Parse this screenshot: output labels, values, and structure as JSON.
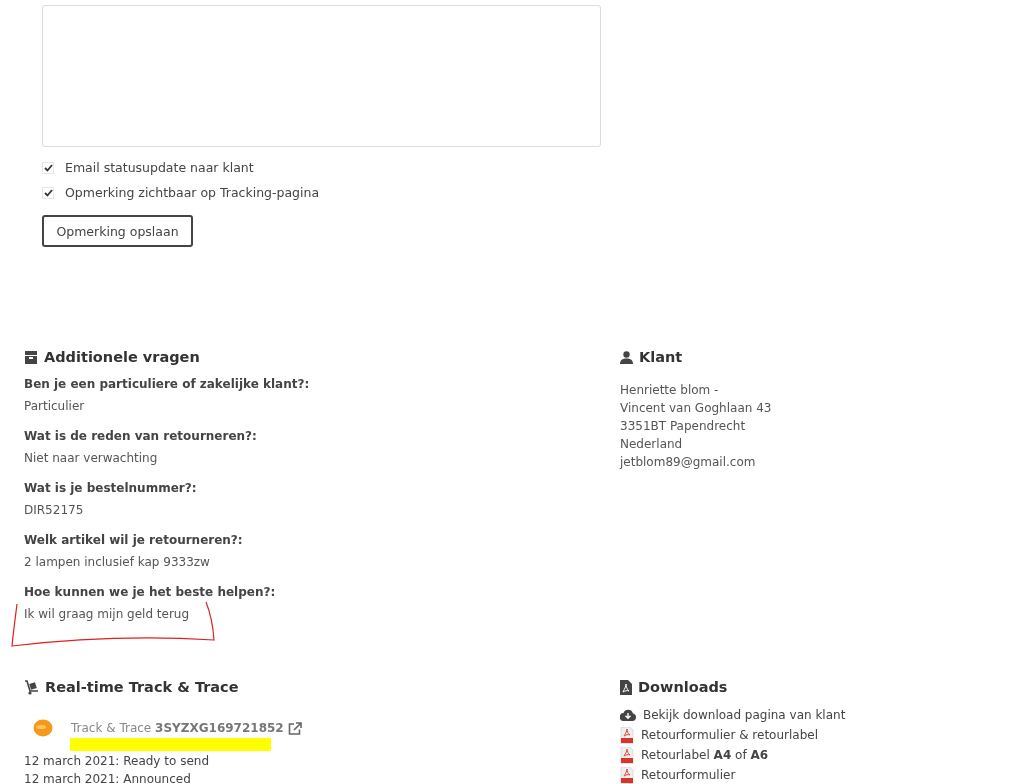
{
  "comment_form": {
    "checkboxes": [
      {
        "label": "Email statusupdate naar klant",
        "checked": true
      },
      {
        "label": "Opmerking zichtbaar op Tracking-pagina",
        "checked": true
      }
    ],
    "save_button": "Opmerking opslaan"
  },
  "additional_questions": {
    "title": "Additionele vragen",
    "items": [
      {
        "question": "Ben je een particuliere of zakelijke klant?:",
        "answer": "Particulier"
      },
      {
        "question": "Wat is de reden van retourneren?:",
        "answer": "Niet naar verwachting"
      },
      {
        "question": "Wat is je bestelnummer?:",
        "answer": "DIR52175"
      },
      {
        "question": "Welk artikel wil je retourneren?:",
        "answer": "2 lampen inclusief kap 9333zw"
      },
      {
        "question": "Hoe kunnen we je het beste helpen?:",
        "answer": "Ik wil graag mijn geld terug"
      }
    ]
  },
  "customer": {
    "title": "Klant",
    "lines": [
      "Henriette blom -",
      "Vincent van Goghlaan 43",
      "3351BT Papendrecht",
      "Nederland",
      "jetblom89@gmail.com"
    ]
  },
  "track_trace": {
    "title": "Real-time Track & Trace",
    "link_label": "Track & Trace",
    "tracking_code": "3SYZXG169721852",
    "events": [
      "12 march 2021: Ready to send",
      "12 march 2021: Announced"
    ]
  },
  "downloads": {
    "title": "Downloads",
    "items": [
      {
        "kind": "cloud",
        "label": "Bekijk download pagina van klant"
      },
      {
        "kind": "pdf",
        "label": "Retourformulier & retourlabel"
      },
      {
        "kind": "pdf",
        "label": "Retourlabel **A4** of **A6**"
      },
      {
        "kind": "pdf",
        "label": "Retourformulier"
      }
    ]
  }
}
